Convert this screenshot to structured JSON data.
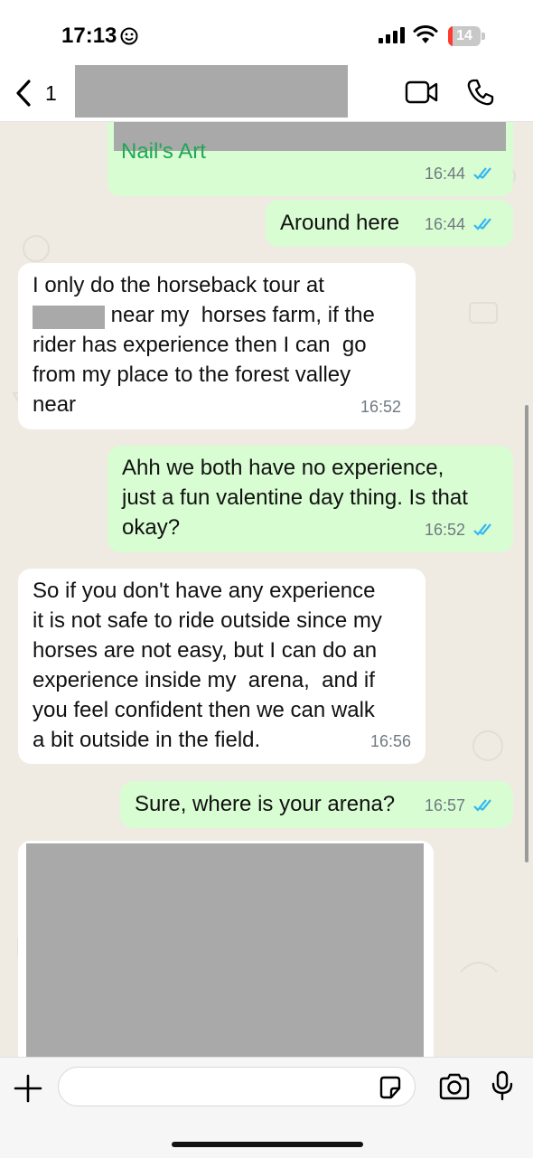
{
  "status_bar": {
    "time": "17:13",
    "battery": "14",
    "battery_level": 0.14,
    "battery_color": "#ff3b30"
  },
  "header": {
    "unread_count": "1",
    "icons": [
      "chevron-left-icon",
      "video-camera-icon",
      "phone-icon"
    ]
  },
  "messages": [
    {
      "direction": "out",
      "text": "Nail's Art",
      "time": "16:44",
      "read": true
    },
    {
      "direction": "out",
      "text": "Around here",
      "time": "16:44",
      "read": true
    },
    {
      "direction": "in",
      "text": "I only do the horseback tour at\n             near my  horses farm, if the\nrider has experience then I can  go\nfrom my place to the forest valley\nnear",
      "time": "16:52"
    },
    {
      "direction": "out",
      "text": "Ahh we both have no experience,\njust a fun valentine day thing. Is that\nokay?",
      "time": "16:52",
      "read": true
    },
    {
      "direction": "in",
      "text": "So if you don't have any experience\nit is not safe to ride outside since my\nhorses are not easy, but I can do an\nexperience inside my  arena,  and if\nyou feel confident then we can walk\na bit outside in the field.",
      "time": "16:56"
    },
    {
      "direction": "out",
      "text": "Sure, where is your arena?",
      "time": "16:57",
      "read": true
    }
  ],
  "colors": {
    "outgoing": "#d9fdd3",
    "incoming": "#ffffff",
    "read_ticks": "#34b7f1",
    "link_text": "#1fa855",
    "background": "#efeae2"
  },
  "input": {
    "value": "",
    "icons": [
      "plus-icon",
      "sticker-icon",
      "camera-icon",
      "microphone-icon"
    ]
  }
}
